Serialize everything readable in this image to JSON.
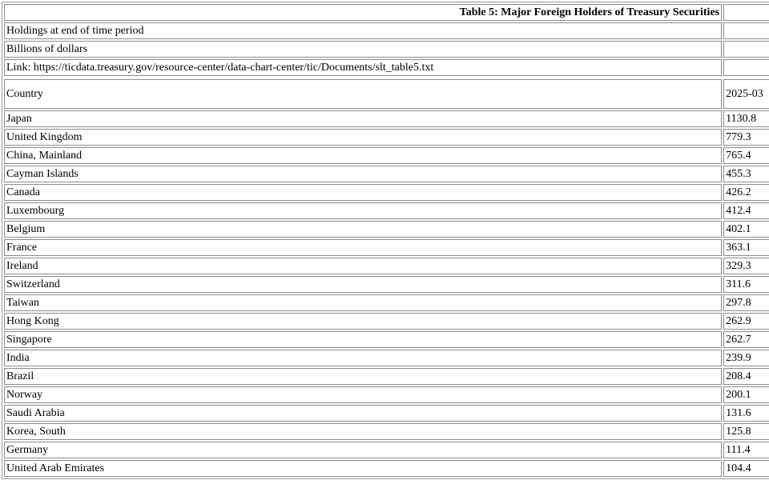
{
  "table": {
    "title": "Table 5: Major Foreign Holders of Treasury Securities",
    "notes": [
      "Holdings at end of time period",
      "Billions of dollars",
      "Link: https://ticdata.treasury.gov/resource-center/data-chart-center/tic/Documents/slt_table5.txt"
    ],
    "header": {
      "country_label": "Country",
      "period_label": "2025-03"
    },
    "rows": [
      {
        "country": "Japan",
        "value": "1130.8"
      },
      {
        "country": "United Kingdom",
        "value": "779.3"
      },
      {
        "country": "China, Mainland",
        "value": "765.4"
      },
      {
        "country": "Cayman Islands",
        "value": "455.3"
      },
      {
        "country": "Canada",
        "value": "426.2"
      },
      {
        "country": "Luxembourg",
        "value": "412.4"
      },
      {
        "country": "Belgium",
        "value": "402.1"
      },
      {
        "country": "France",
        "value": "363.1"
      },
      {
        "country": "Ireland",
        "value": "329.3"
      },
      {
        "country": "Switzerland",
        "value": "311.6"
      },
      {
        "country": "Taiwan",
        "value": "297.8"
      },
      {
        "country": "Hong Kong",
        "value": "262.9"
      },
      {
        "country": "Singapore",
        "value": "262.7"
      },
      {
        "country": "India",
        "value": "239.9"
      },
      {
        "country": "Brazil",
        "value": "208.4"
      },
      {
        "country": "Norway",
        "value": "200.1"
      },
      {
        "country": "Saudi Arabia",
        "value": "131.6"
      },
      {
        "country": "Korea, South",
        "value": "125.8"
      },
      {
        "country": "Germany",
        "value": "111.4"
      },
      {
        "country": "United Arab Emirates",
        "value": "104.4"
      }
    ]
  }
}
